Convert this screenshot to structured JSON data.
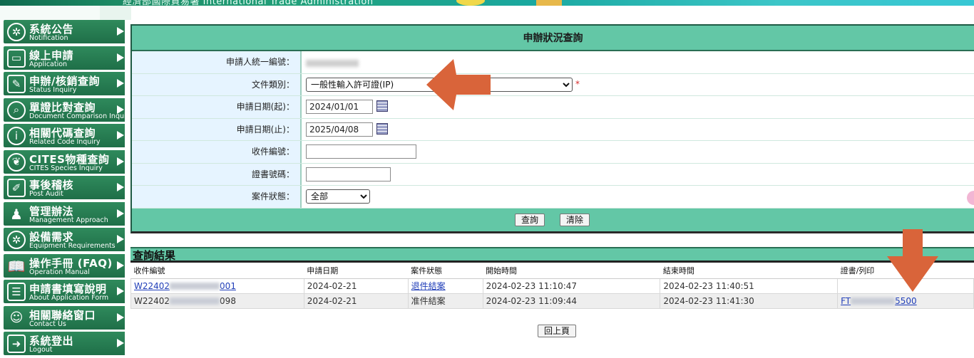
{
  "banner": {
    "text": "經濟部國際貿易署 International Trade Administration"
  },
  "sidebar": {
    "items": [
      {
        "zh": "系統公告",
        "en": "Notification",
        "icon": "gear-icon"
      },
      {
        "zh": "線上申請",
        "en": "Application",
        "icon": "monitor-icon"
      },
      {
        "zh": "申辦/核銷查詢",
        "en": "Status Inquiry",
        "icon": "edit-document-icon"
      },
      {
        "zh": "單證比對查詢",
        "en": "Document Comparison Inquiry",
        "icon": "search-icon"
      },
      {
        "zh": "相關代碼查詢",
        "en": "Related Code Inquiry",
        "icon": "info-icon"
      },
      {
        "zh": "CITES物種查詢",
        "en": "CITES Species Inquiry",
        "icon": "leaf-icon"
      },
      {
        "zh": "事後稽核",
        "en": "Post Audit",
        "icon": "pencil-note-icon"
      },
      {
        "zh": "管理辦法",
        "en": "Management Approach",
        "icon": "user-icon"
      },
      {
        "zh": "設備需求",
        "en": "Equipment Requirements",
        "icon": "settings-icon"
      },
      {
        "zh": "操作手冊 (FAQ)",
        "en": "Operation Manual",
        "icon": "book-icon"
      },
      {
        "zh": "申請書填寫說明",
        "en": "About Application Form",
        "icon": "form-icon"
      },
      {
        "zh": "相關聯絡窗口",
        "en": "Contact Us",
        "icon": "contacts-icon"
      },
      {
        "zh": "系統登出",
        "en": "Logout",
        "icon": "logout-icon"
      }
    ]
  },
  "query": {
    "title": "申辦狀況查詢",
    "fields": {
      "applicant_id": {
        "label": "申請人統一編號："
      },
      "doc_type": {
        "label": "文件類別：",
        "value": "一般性輸入許可證(IP)",
        "required_mark": "*"
      },
      "date_from": {
        "label": "申請日期(起)：",
        "value": "2024/01/01"
      },
      "date_to": {
        "label": "申請日期(止)：",
        "value": "2025/04/08"
      },
      "receipt_no": {
        "label": "收件編號：",
        "value": ""
      },
      "cert_no": {
        "label": "證書號碼：",
        "value": ""
      },
      "case_status": {
        "label": "案件狀態：",
        "value": "全部"
      }
    },
    "buttons": {
      "query": "查詢",
      "clear": "清除"
    }
  },
  "results": {
    "title": "查詢結果",
    "columns": [
      "收件編號",
      "申請日期",
      "案件狀態",
      "開始時間",
      "結束時間",
      "證書/列印"
    ],
    "rows": [
      {
        "receipt_prefix": "W22402",
        "receipt_suffix": "001",
        "apply_date": "2024-02-21",
        "status": "退件結案",
        "start": "2024-02-23 11:10:47",
        "end": "2024-02-23 11:40:51",
        "cert_prefix": "",
        "cert_suffix": ""
      },
      {
        "receipt_prefix": "W22402",
        "receipt_suffix": "098",
        "apply_date": "2024-02-21",
        "status": "准件結案",
        "start": "2024-02-23 11:09:44",
        "end": "2024-02-23 11:41:30",
        "cert_prefix": "FT",
        "cert_suffix": "5500"
      }
    ],
    "back_button": "回上頁"
  },
  "colors": {
    "accent_green": "#63c7a6",
    "sidebar_green": "#2f8a5c",
    "arrow_orange": "#d9643a",
    "link_blue": "#1f3db8"
  }
}
